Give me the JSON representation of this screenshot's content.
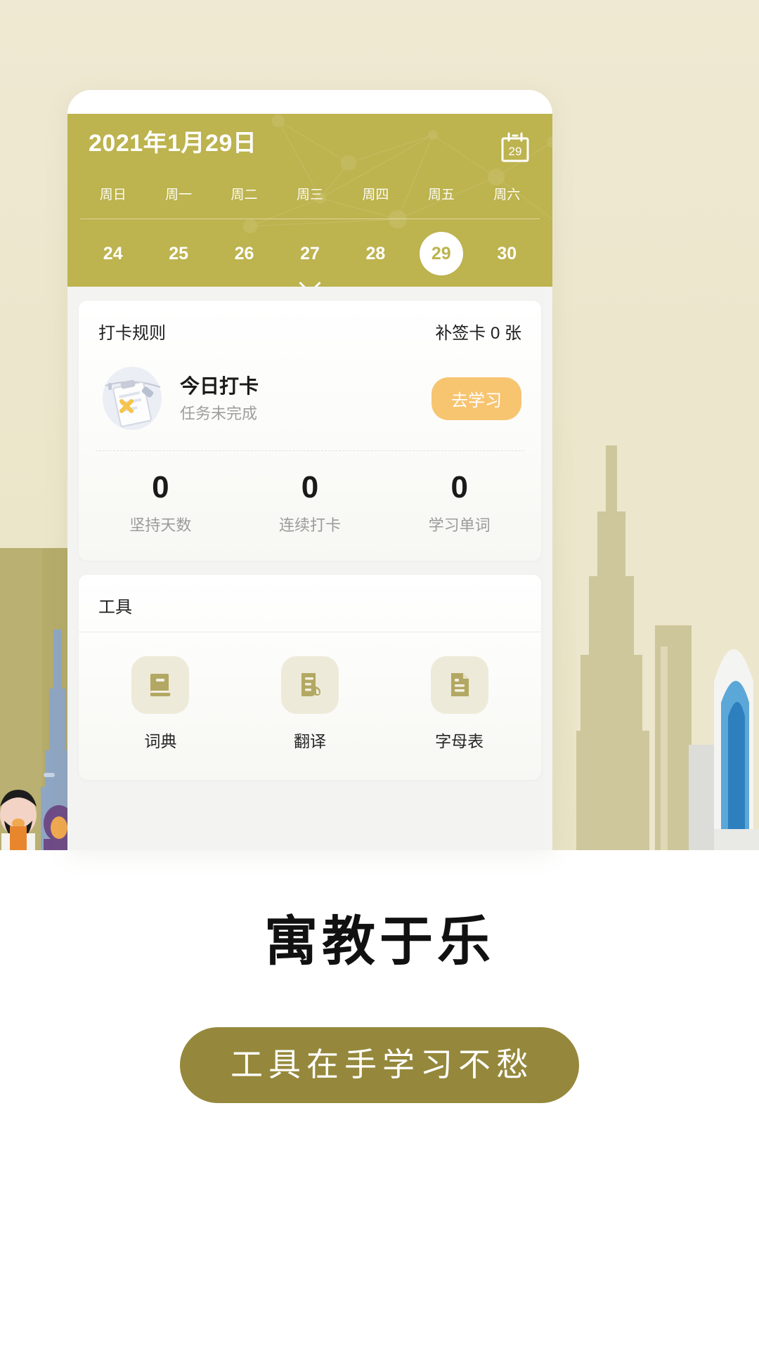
{
  "background": {
    "theme_colors": {
      "page_bg": "#ece7cf",
      "bottom_bg": "#ffffff",
      "header_olive": "#bdb34f",
      "promo_olive": "#95883c",
      "accent_orange": "#f7c470",
      "tool_icon": "#b3a863"
    }
  },
  "phone": {
    "calendar": {
      "title": "2021年1月29日",
      "calendar_icon_label": "29",
      "weekdays": [
        "周日",
        "周一",
        "周二",
        "周三",
        "周四",
        "周五",
        "周六"
      ],
      "days": [
        {
          "num": "24",
          "active": false
        },
        {
          "num": "25",
          "active": false
        },
        {
          "num": "26",
          "active": false
        },
        {
          "num": "27",
          "active": false
        },
        {
          "num": "28",
          "active": false
        },
        {
          "num": "29",
          "active": true
        },
        {
          "num": "30",
          "active": false
        }
      ],
      "expand_icon": "chevron-down-icon"
    },
    "checkin_card": {
      "rules_label": "打卡规则",
      "makeup_cards_label": "补签卡 0 张",
      "today_title": "今日打卡",
      "today_status": "任务未完成",
      "action_button": "去学习",
      "stats": [
        {
          "value": "0",
          "label": "坚持天数"
        },
        {
          "value": "0",
          "label": "连续打卡"
        },
        {
          "value": "0",
          "label": "学习单词"
        }
      ]
    },
    "tools_card": {
      "section_title": "工具",
      "tools": [
        {
          "label": "词典",
          "icon": "book-icon"
        },
        {
          "label": "翻译",
          "icon": "translate-document-icon"
        },
        {
          "label": "字母表",
          "icon": "file-text-icon"
        }
      ]
    }
  },
  "promo": {
    "headline": "寓教于乐",
    "button_label": "工具在手学习不愁"
  }
}
